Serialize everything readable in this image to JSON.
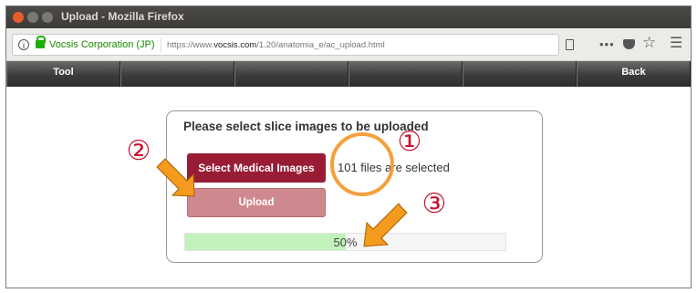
{
  "window": {
    "title": "Upload - Mozilla Firefox"
  },
  "browser": {
    "site_name": "Vocsis Corporation (JP)",
    "url_prefix": "https://www.",
    "url_domain": "vocsis.com",
    "url_path": "/1.20/anatomia_e/ac_upload.html"
  },
  "nav": {
    "items": [
      {
        "label": "Tool"
      },
      {
        "label": ""
      },
      {
        "label": ""
      },
      {
        "label": ""
      },
      {
        "label": ""
      },
      {
        "label": "Back"
      }
    ]
  },
  "upload": {
    "title": "Please select slice images to be uploaded",
    "select_button": "Select Medical Images",
    "files_status": "101 files are selected",
    "upload_button": "Upload",
    "progress_fraction": 0.5,
    "progress_label": "50%"
  },
  "annotations": {
    "step1": "①",
    "step2": "②",
    "step3": "③"
  },
  "colors": {
    "brand": "#991c35",
    "upload_button": "#d0888f",
    "progress_fill": "#c2f2bc",
    "annotation_circle": "#f5a03c",
    "annotation_arrow": "#f39a1f",
    "annotation_number": "#c8102e"
  }
}
